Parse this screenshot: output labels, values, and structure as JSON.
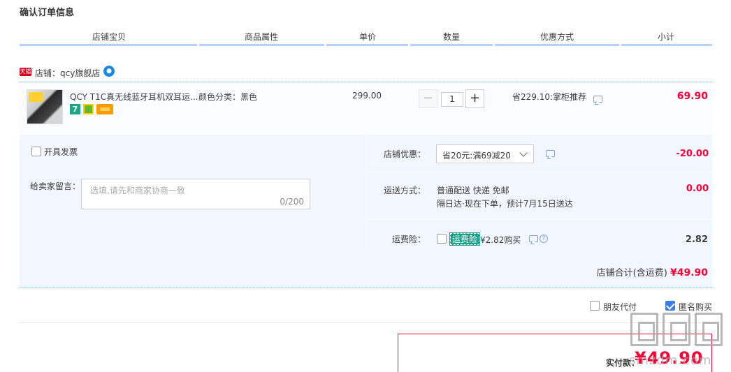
{
  "page_title": "确认订单信息",
  "table_headers": [
    "店铺宝贝",
    "商品属性",
    "单价",
    "数量",
    "优惠方式",
    "小计"
  ],
  "shop": {
    "badge": "天猫",
    "label": "店铺：qcy旗舰店"
  },
  "item": {
    "name": "QCY T1C真无线蓝牙耳机双耳运...",
    "attr": "颜色分类：黑色",
    "price": "299.00",
    "quantity": "1",
    "qty_minus": "−",
    "qty_plus": "+",
    "badge_7": "7",
    "discount": "省229.10:掌柜推荐",
    "subtotal": "69.90"
  },
  "invoice_label": "开具发票",
  "memo": {
    "label": "给卖家留言：",
    "placeholder": "选填,请先和商家协商一致",
    "counter": "0/200"
  },
  "shop_discount": {
    "label": "店铺优惠：",
    "selected": "省20元:满69减20",
    "amount": "-20.00"
  },
  "shipping": {
    "label": "运送方式：",
    "line1": "普通配送 快递 免邮",
    "line2": "隔日达·现在下单，预计7月15日送达",
    "amount": "0.00"
  },
  "insurance": {
    "label": "运费险：",
    "tag": "运费险",
    "price_text": "¥2.82购买",
    "help": "?",
    "amount": "2.82"
  },
  "shop_total": {
    "label": "店铺合计(含运费)",
    "value": "¥49.90"
  },
  "friend_pay_label": "朋友代付",
  "anonymous_label": "匿名购买",
  "anonymous_checked": true,
  "payment": {
    "label": "实付款：",
    "amount": "¥49.90"
  },
  "watermark": {
    "site": "smzdm.com"
  },
  "colors": {
    "accent_red": "#ff0036",
    "header_bar": "#b2d1ff",
    "panel_bg": "#f2f7ff",
    "checkbox_blue": "#3a7de8",
    "insurance_green": "#16a085"
  }
}
